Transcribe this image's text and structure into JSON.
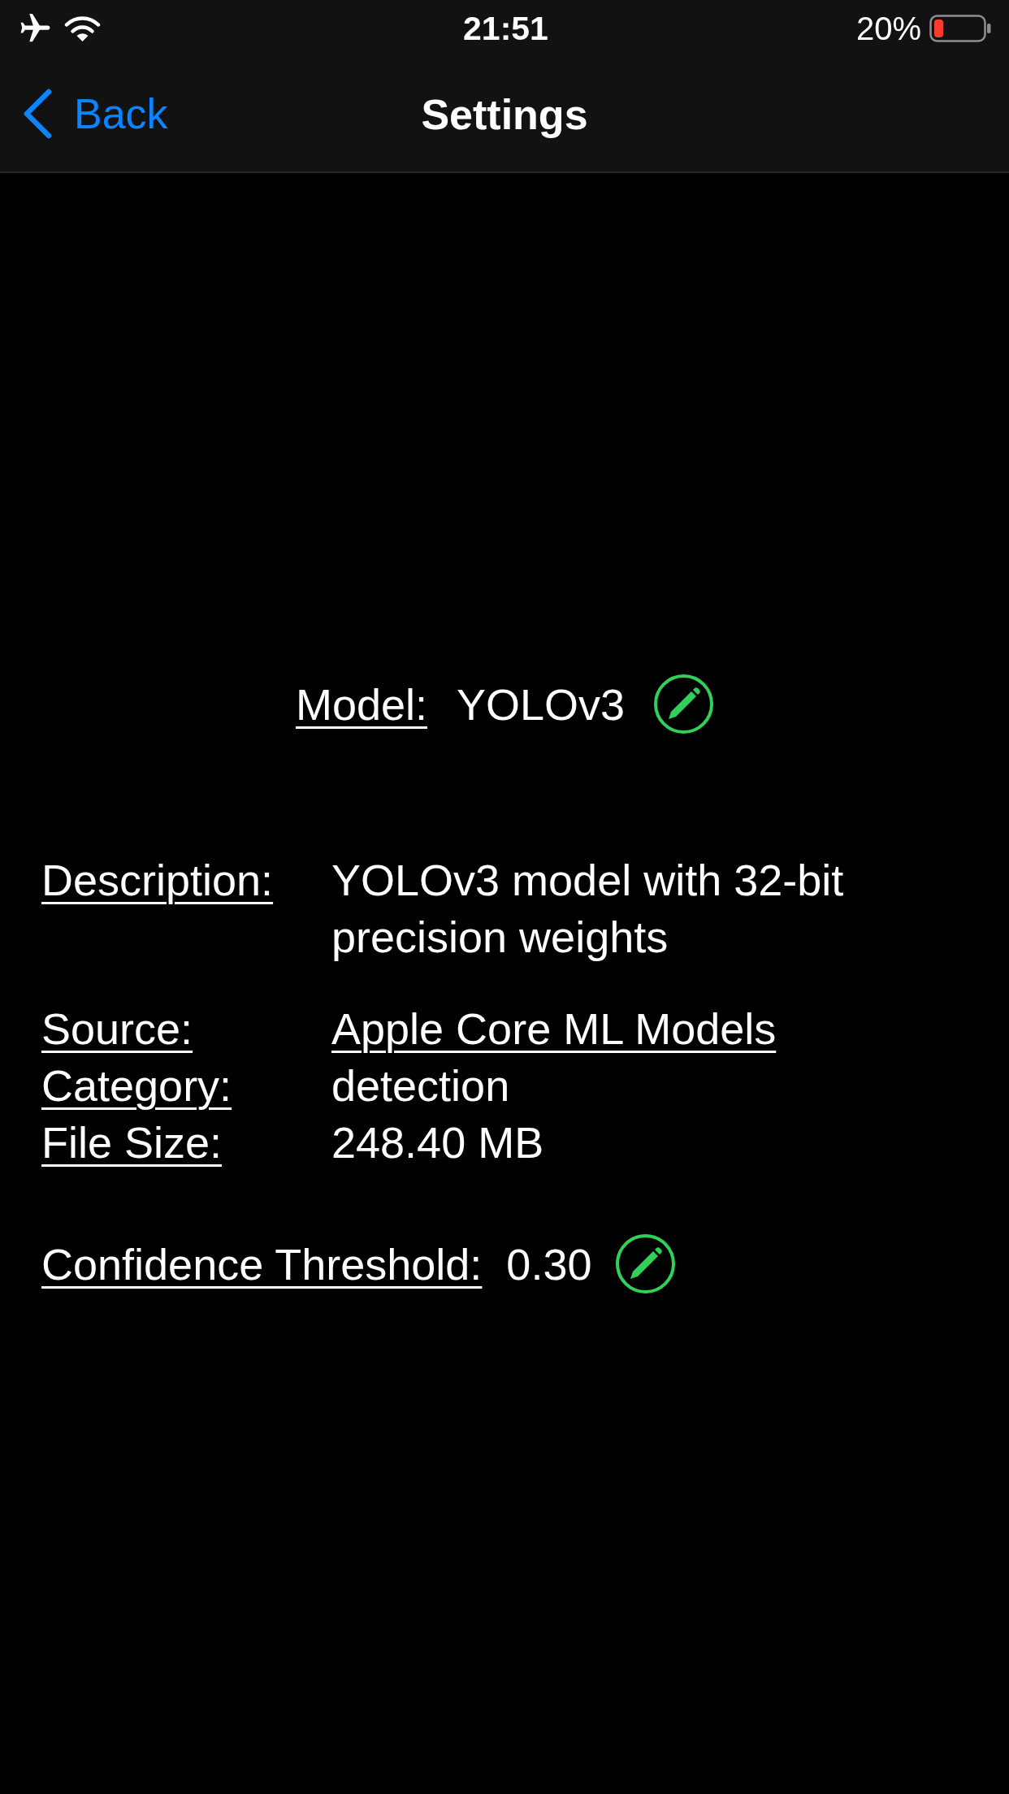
{
  "status_bar": {
    "time": "21:51",
    "battery_percent": "20%"
  },
  "nav_bar": {
    "back_label": "Back",
    "title": "Settings"
  },
  "model": {
    "label": "Model:",
    "value": "YOLOv3"
  },
  "details": [
    {
      "rows": [
        {
          "kind": "text",
          "label": "Description:",
          "value": "YOLOv3 model with 32-bit precision weights"
        }
      ]
    },
    {
      "rows": [
        {
          "kind": "link",
          "label": "Source:",
          "value": "Apple Core ML Models"
        },
        {
          "kind": "text",
          "label": "Category:",
          "value": "detection"
        },
        {
          "kind": "text",
          "label": "File Size:",
          "value": "248.40 MB"
        }
      ]
    }
  ],
  "confidence": {
    "label": "Confidence Threshold:",
    "value": "0.30"
  }
}
